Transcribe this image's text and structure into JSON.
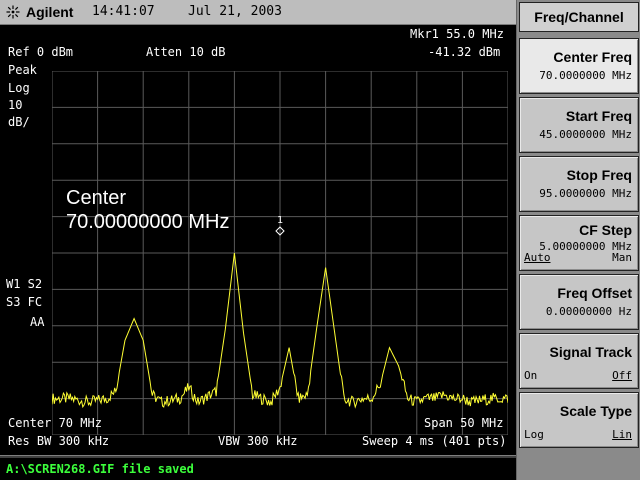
{
  "header": {
    "brand": "Agilent",
    "time": "14:41:07",
    "date": "Jul 21, 2003"
  },
  "display": {
    "ref_level": "Ref 0 dBm",
    "atten": "Atten 10 dB",
    "mkr_label": "Mkr1 55.0 MHz",
    "mkr_value": "-41.32 dBm",
    "detector": "Peak",
    "scale_type": "Log",
    "scale_div": "10",
    "scale_unit": "dB/",
    "marker_number": "1",
    "center_annot_1": "Center",
    "center_annot_2": "70.00000000 MHz",
    "left_annot_1": "W1  S2",
    "left_annot_2": "S3  FC",
    "left_annot_3": "AA",
    "center_freq": "Center 70 MHz",
    "span": "Span 50 MHz",
    "res_bw": "Res BW 300 kHz",
    "vbw": "VBW 300 kHz",
    "sweep": "Sweep 4 ms (401 pts)"
  },
  "status": {
    "message": "A:\\SCREN268.GIF file saved"
  },
  "softkeys": {
    "title": "Freq/Channel",
    "items": [
      {
        "label": "Center Freq",
        "value": "70.0000000 MHz"
      },
      {
        "label": "Start Freq",
        "value": "45.0000000 MHz"
      },
      {
        "label": "Stop Freq",
        "value": "95.0000000 MHz"
      },
      {
        "label": "CF Step",
        "value": "5.00000000 MHz",
        "opt_left": "Auto",
        "opt_right": "Man"
      },
      {
        "label": "Freq Offset",
        "value": "0.00000000 Hz"
      },
      {
        "label": "Signal Track",
        "opt_left": "On",
        "opt_right": "Off"
      },
      {
        "label": "Scale Type",
        "opt_left": "Log",
        "opt_right": "Lin"
      }
    ]
  },
  "colors": {
    "trace": "#ffff33",
    "grid": "#5a5a5a",
    "status_text": "#3cff3c"
  },
  "chart_data": {
    "type": "line",
    "x": [
      45,
      47,
      49,
      51,
      52,
      53,
      54,
      55,
      56,
      57,
      59,
      60,
      61,
      63,
      64,
      65,
      66,
      67,
      69,
      70,
      71,
      72,
      73,
      74,
      75,
      76,
      77,
      78,
      79,
      80,
      81,
      82,
      83,
      84,
      85,
      86,
      87,
      88,
      89,
      90,
      91,
      93,
      95
    ],
    "values": [
      -90,
      -90,
      -91,
      -90,
      -88,
      -74,
      -68,
      -74,
      -89,
      -91,
      -90,
      -87,
      -91,
      -88,
      -71,
      -50,
      -72,
      -89,
      -91,
      -87,
      -76,
      -90,
      -89,
      -71,
      -54,
      -72,
      -90,
      -91,
      -90,
      -90,
      -86,
      -76,
      -81,
      -90,
      -91,
      -90,
      -90,
      -89,
      -90,
      -90,
      -91,
      -90,
      -90
    ],
    "xlim": [
      45,
      95
    ],
    "ylim": [
      -100,
      0
    ],
    "grid": true
  }
}
